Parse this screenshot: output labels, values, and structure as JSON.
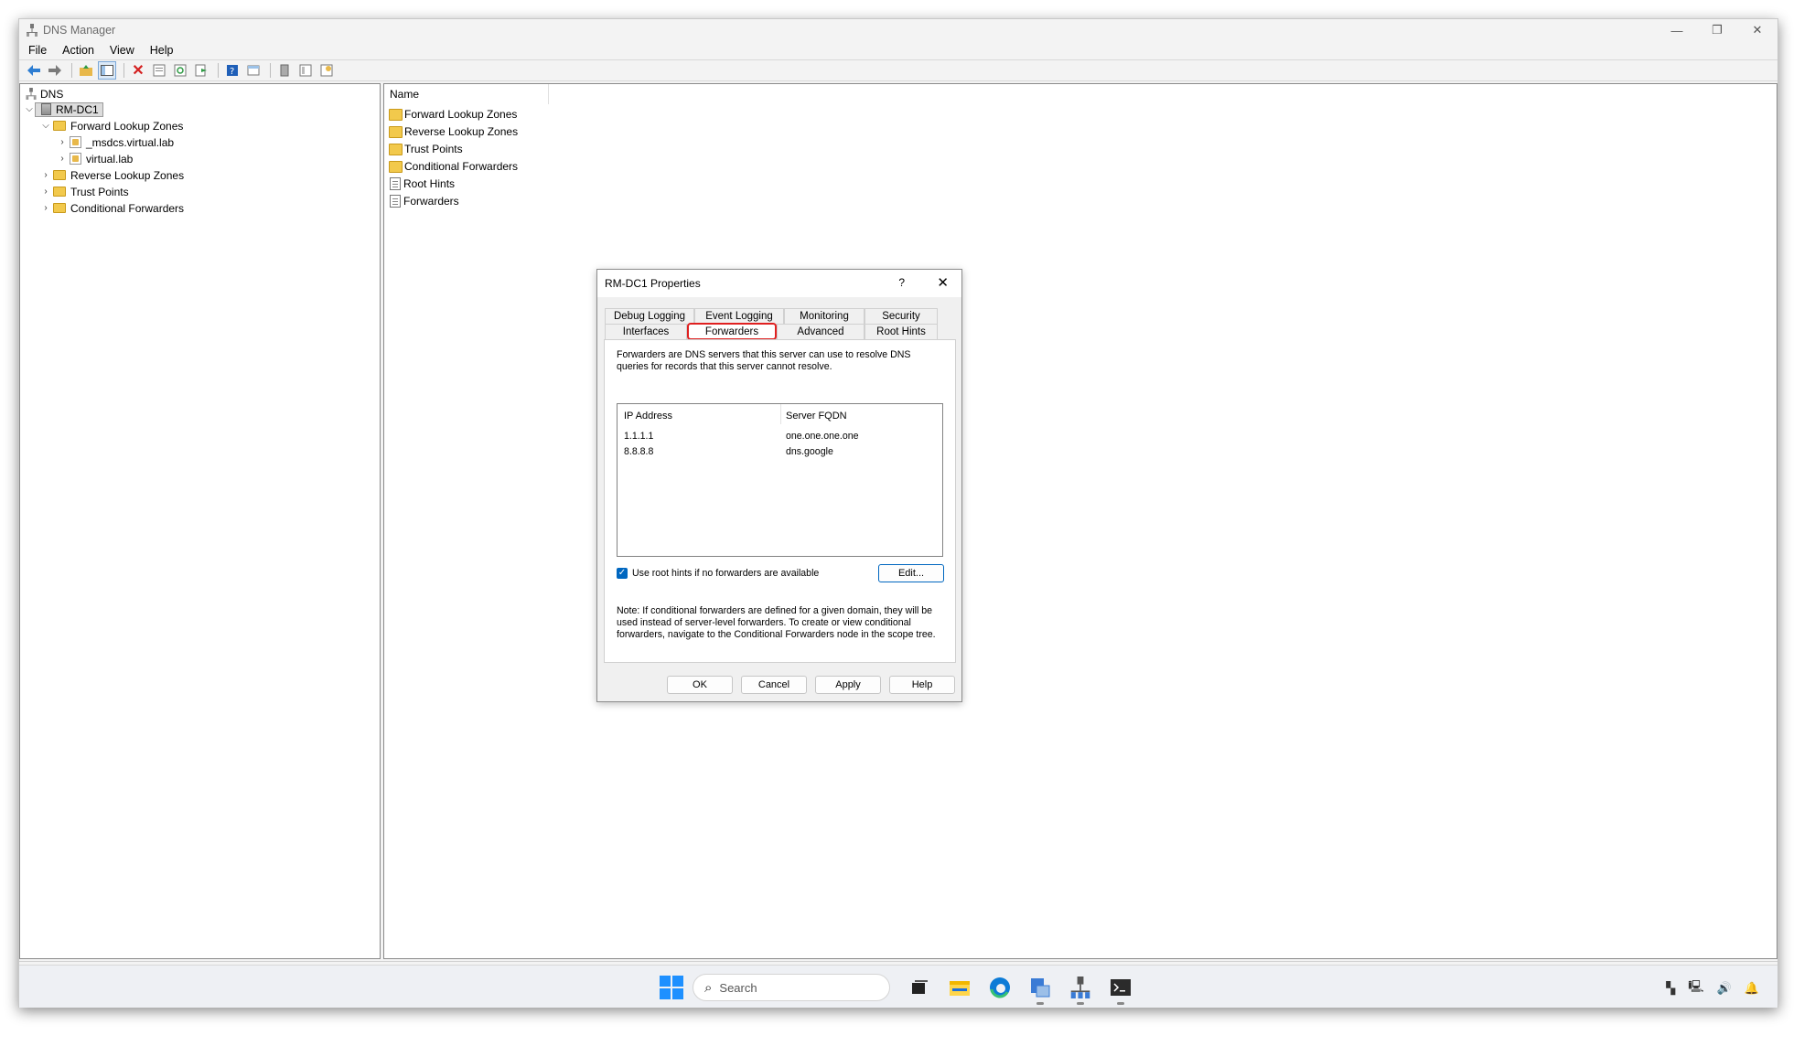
{
  "window": {
    "title": "DNS Manager",
    "controls": {
      "minimize": "—",
      "restore": "❐",
      "close": "✕"
    }
  },
  "menu": [
    "File",
    "Action",
    "View",
    "Help"
  ],
  "tree": {
    "root": "DNS",
    "server": "RM-DC1",
    "forward_zones": "Forward Lookup Zones",
    "zones": [
      "_msdcs.virtual.lab",
      "virtual.lab"
    ],
    "reverse_zones": "Reverse Lookup Zones",
    "trust_points": "Trust Points",
    "conditional_forwarders": "Conditional Forwarders"
  },
  "list": {
    "header": "Name",
    "items": [
      {
        "label": "Forward Lookup Zones",
        "icon": "folder-icon"
      },
      {
        "label": "Reverse Lookup Zones",
        "icon": "folder-icon"
      },
      {
        "label": "Trust Points",
        "icon": "folder-icon"
      },
      {
        "label": "Conditional Forwarders",
        "icon": "folder-icon"
      },
      {
        "label": "Root Hints",
        "icon": "document-icon"
      },
      {
        "label": "Forwarders",
        "icon": "document-icon"
      }
    ]
  },
  "dialog": {
    "title": "RM-DC1 Properties",
    "help": "?",
    "close": "✕",
    "tabs_top": [
      "Debug Logging",
      "Event Logging",
      "Monitoring",
      "Security"
    ],
    "tabs_bottom": [
      "Interfaces",
      "Forwarders",
      "Advanced",
      "Root Hints"
    ],
    "active_tab": "Forwarders",
    "description": "Forwarders are DNS servers that this server can use to resolve DNS queries for records that this server cannot resolve.",
    "columns": [
      "IP Address",
      "Server FQDN"
    ],
    "forwarders": [
      {
        "ip": "1.1.1.1",
        "fqdn": "one.one.one.one"
      },
      {
        "ip": "8.8.8.8",
        "fqdn": "dns.google"
      }
    ],
    "use_root_hints_label": "Use root hints if no forwarders are available",
    "use_root_hints_checked": true,
    "edit_button": "Edit...",
    "note": "Note: If conditional forwarders are defined for a given domain, they will be used instead of server-level forwarders.  To create or view conditional forwarders, navigate to the Conditional Forwarders node in the scope tree.",
    "buttons": {
      "ok": "OK",
      "cancel": "Cancel",
      "apply": "Apply",
      "help": "Help"
    }
  },
  "taskbar": {
    "search_placeholder": "Search",
    "accent_color": "#0067c0"
  }
}
